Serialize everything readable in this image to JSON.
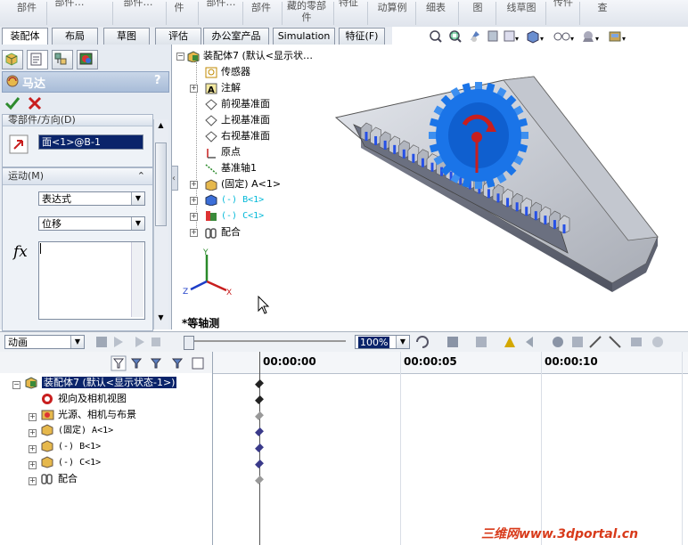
{
  "ribbon": {
    "items": [
      "部件",
      "部件…",
      "部件…",
      "件",
      "部件…",
      "部件",
      "藏的零部件",
      "特征",
      "动算例",
      "细表",
      "图",
      "线草图",
      "传件",
      "查"
    ]
  },
  "tabs": [
    "装配体",
    "布局",
    "草图",
    "评估",
    "办公室产品",
    "Simulation",
    "特征(F)"
  ],
  "property_manager": {
    "title": "马达",
    "help": "?",
    "ok_icon": "check-icon",
    "cancel_icon": "x-icon",
    "group1_title": "零部件/方向(D)",
    "face_value": "面<1>@B-1",
    "motion_title": "运动(M)",
    "motion_type": "表达式",
    "motion_quantity": "位移",
    "fx_label": "fx",
    "expression_value": ""
  },
  "feature_tree": {
    "root": "装配体7  (默认<显示状…",
    "items": [
      {
        "label": "传感器",
        "icon": "sensor-icon",
        "color": "#000000"
      },
      {
        "label": "注解",
        "icon": "annotation-icon",
        "color": "#000000"
      },
      {
        "label": "前视基准面",
        "icon": "plane-icon",
        "color": "#000000"
      },
      {
        "label": "上视基准面",
        "icon": "plane-icon",
        "color": "#000000"
      },
      {
        "label": "右视基准面",
        "icon": "plane-icon",
        "color": "#000000"
      },
      {
        "label": "原点",
        "icon": "origin-icon",
        "color": "#000000"
      },
      {
        "label": "基准轴1",
        "icon": "axis-icon",
        "color": "#000000"
      },
      {
        "label": "(固定) A<1>",
        "icon": "part-icon",
        "color": "#000000"
      },
      {
        "label": "(-) B<1>",
        "icon": "part-icon",
        "color": "#00b8d8"
      },
      {
        "label": "(-) C<1>",
        "icon": "part-icon",
        "color": "#00b8d8"
      },
      {
        "label": "配合",
        "icon": "mate-icon",
        "color": "#000000"
      }
    ]
  },
  "viewport": {
    "view_label": "*等轴测",
    "axis_x": "X",
    "axis_y": "Y",
    "axis_z": "Z"
  },
  "motion": {
    "study_type": "动画",
    "zoom": "100%",
    "time_labels": [
      "00:00:00",
      "00:00:05",
      "00:00:10"
    ],
    "tree": [
      {
        "label": "装配体7  (默认<显示状态-1>)",
        "icon": "assembly-icon"
      },
      {
        "label": "视向及相机视图",
        "icon": "camera-icon"
      },
      {
        "label": "光源、相机与布景",
        "icon": "light-icon"
      },
      {
        "label": "(固定) A<1>",
        "icon": "part-icon"
      },
      {
        "label": "(-) B<1>",
        "icon": "part-icon"
      },
      {
        "label": "(-) C<1>",
        "icon": "part-icon"
      },
      {
        "label": "配合",
        "icon": "mate-icon"
      }
    ]
  },
  "watermark": "三维网www.3dportal.cn",
  "colors": {
    "accent": "#0a246a",
    "selection": "#0a246a",
    "gear_blue": "#1a74e8",
    "keyframe": "#3a3a8a"
  }
}
